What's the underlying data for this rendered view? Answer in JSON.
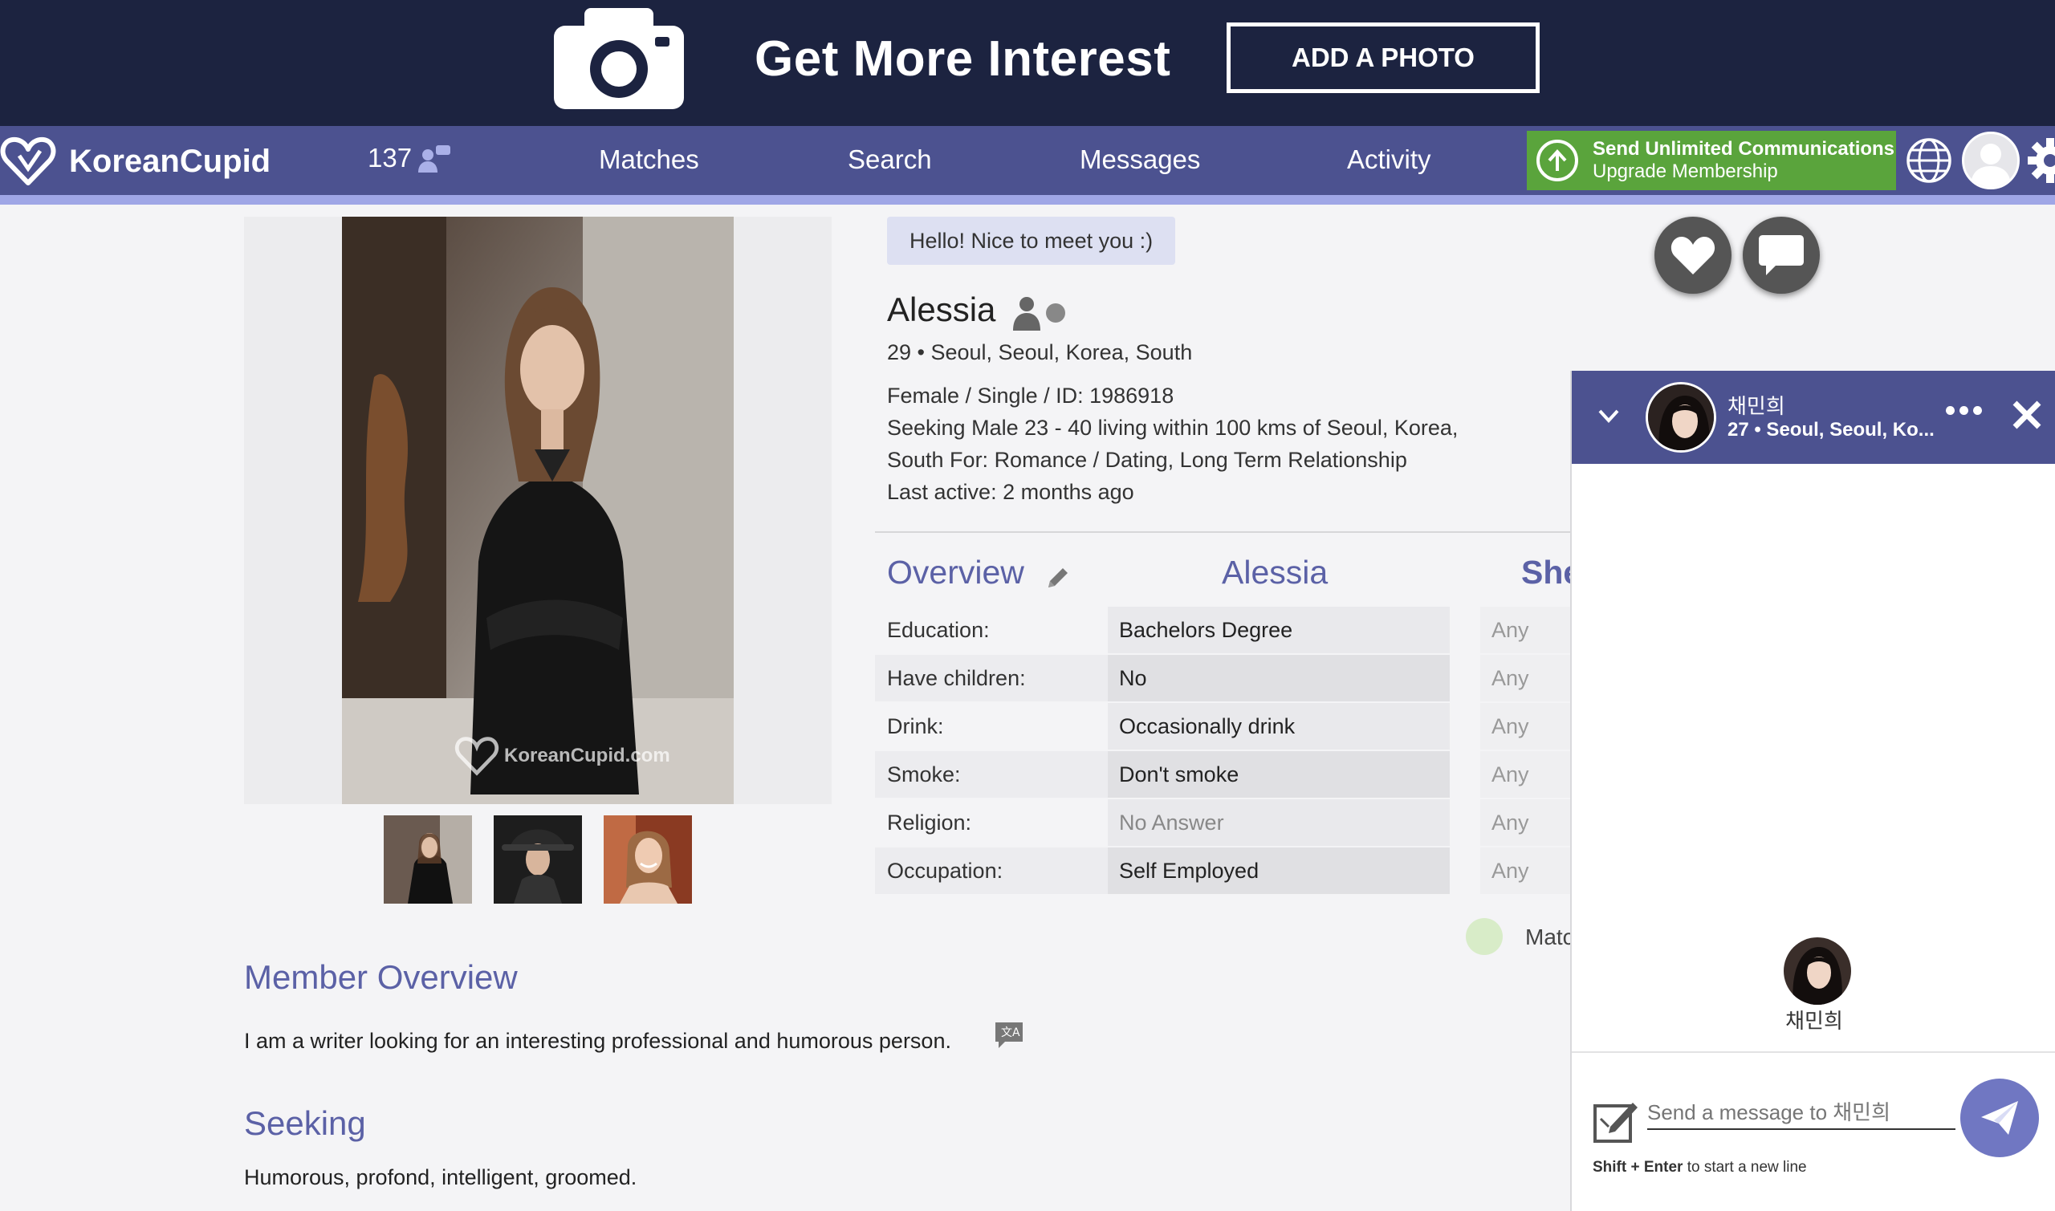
{
  "banner": {
    "headline": "Get More Interest",
    "button_label": "ADD A PHOTO"
  },
  "nav": {
    "logo_text": "KoreanCupid",
    "count": "137",
    "links": [
      "Matches",
      "Search",
      "Messages",
      "Activity"
    ],
    "upgrade_line1": "Send Unlimited Communications",
    "upgrade_line2": "Upgrade Membership"
  },
  "profile": {
    "greeting": "Hello! Nice to meet you :)",
    "name": "Alessia",
    "age_location": "29 • Seoul, Seoul, Korea, South",
    "details": "Female / Single / ID: 1986918",
    "seeking_line1": "Seeking Male 23 - 40 living within 100 kms of Seoul, Korea,",
    "seeking_line2": "South For: Romance / Dating, Long Term Relationship",
    "last_active": "Last active: 2 months ago"
  },
  "overview": {
    "title": "Overview",
    "col_name": "Alessia",
    "col_she": "She",
    "rows": [
      {
        "label": "Education:",
        "value": "Bachelors Degree",
        "pref": "Any"
      },
      {
        "label": "Have children:",
        "value": "No",
        "pref": "Any"
      },
      {
        "label": "Drink:",
        "value": "Occasionally drink",
        "pref": "Any"
      },
      {
        "label": "Smoke:",
        "value": "Don't smoke",
        "pref": "Any"
      },
      {
        "label": "Religion:",
        "value": "No Answer",
        "pref": "Any"
      },
      {
        "label": "Occupation:",
        "value": "Self Employed",
        "pref": "Any"
      }
    ],
    "match_text": "Matc"
  },
  "member_overview": {
    "title": "Member Overview",
    "text": "I am a writer looking for an interesting professional and humorous person."
  },
  "seeking": {
    "title": "Seeking",
    "text": "Humorous, profond, intelligent, groomed."
  },
  "photo": {
    "watermark": "KoreanCupid.com"
  },
  "chat": {
    "name": "채민희",
    "location": "27 • Seoul, Seoul, Ko...",
    "mid_name": "채민희",
    "placeholder": "Send a message to 채민희",
    "hint_keys": "Shift + Enter",
    "hint_text": " to start a new line"
  },
  "colors": {
    "banner": "#1c2340",
    "nav": "#4c5290",
    "accent": "#5b61a6",
    "upgrade": "#5aa43c",
    "send": "#7077c2"
  }
}
